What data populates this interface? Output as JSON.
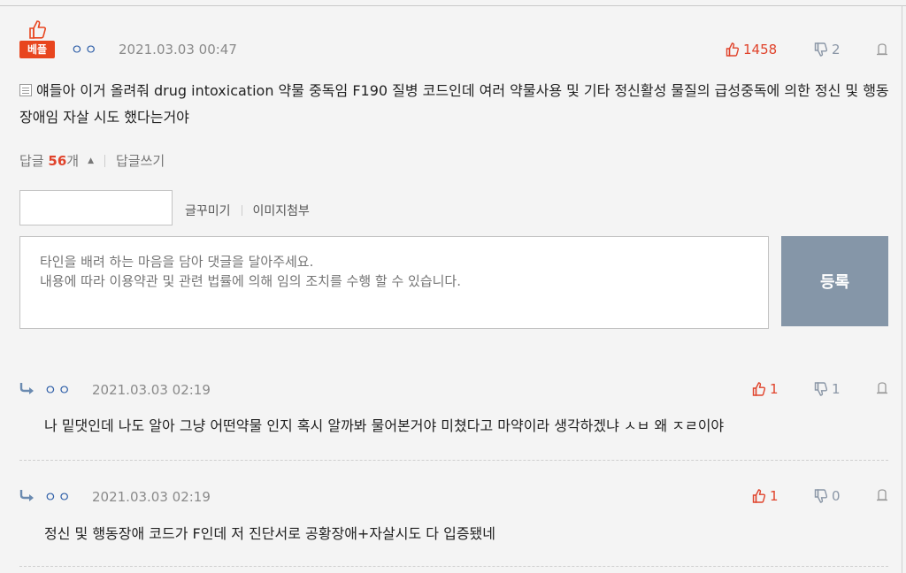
{
  "main_comment": {
    "badge": "베플",
    "nickname": "ㅇㅇ",
    "date": "2021.03.03 00:47",
    "likes": "1458",
    "dislikes": "2",
    "content": "얘들아 이거 올려줘 drug intoxication 약물 중독임 F190 질병 코드인데 여러 약물사용 및 기타 정신활성 물질의 급성중독에 의한 정신 및 행동 장애임 자살 시도 했다는거야"
  },
  "reply_bar": {
    "label": "답글",
    "count": "56",
    "unit": "개",
    "write_label": "답글쓰기"
  },
  "form": {
    "nickname_value": "",
    "decorate_label": "글꾸미기",
    "image_label": "이미지첨부",
    "placeholder": "타인을 배려 하는 마음을 담아 댓글을 달아주세요.\n내용에 따라 이용약관 및 관련 법률에 의해 임의 조치를 수행 할 수 있습니다.",
    "submit_label": "등록"
  },
  "replies": [
    {
      "nickname": "ㅇㅇ",
      "date": "2021.03.03 02:19",
      "likes": "1",
      "dislikes": "1",
      "content": "나 밑댓인데 나도 알아 그냥 어떤약물 인지 혹시 알까봐 물어본거야 미쳤다고 마약이라 생각하겠냐 ㅅㅂ 왜 ㅈㄹ이야"
    },
    {
      "nickname": "ㅇㅇ",
      "date": "2021.03.03 02:19",
      "likes": "1",
      "dislikes": "0",
      "content": "정신 및 행동장애 코드가 F인데 저 진단서로 공황장애+자살시도 다 입증됐네"
    }
  ],
  "colors": {
    "accent_red": "#e0432b",
    "badge_red": "#e8451e",
    "submit_bg": "#8596a8",
    "nickname_blue": "#2f5fa8"
  }
}
